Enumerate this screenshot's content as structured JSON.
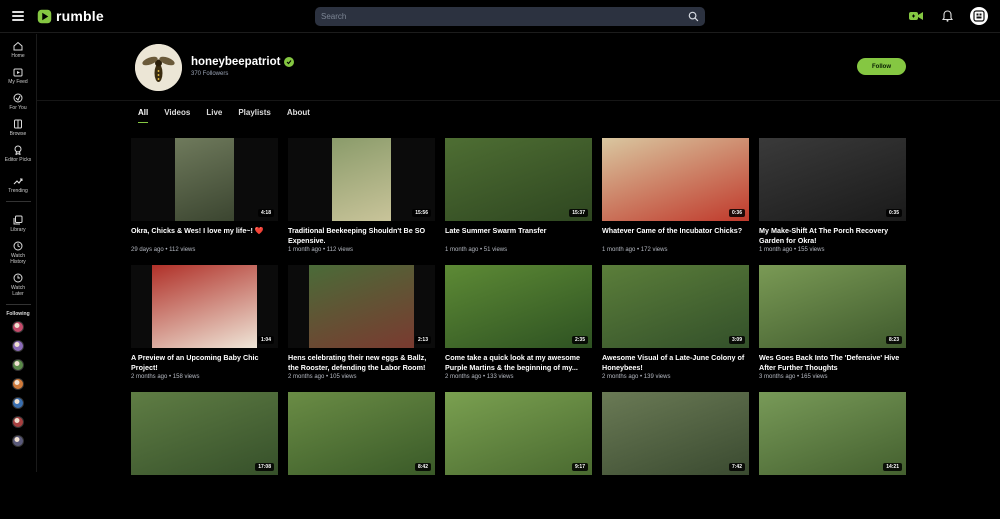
{
  "brand": {
    "name": "rumble",
    "accent": "#85c742"
  },
  "search": {
    "placeholder": "Search"
  },
  "topbar_icons": [
    "menu-icon",
    "search-icon",
    "upload-camera-icon",
    "bell-icon",
    "user-avatar-icon"
  ],
  "sidebar": {
    "items": [
      {
        "label": "Home",
        "icon": "home-icon"
      },
      {
        "label": "My Feed",
        "icon": "feed-icon"
      },
      {
        "label": "For You",
        "icon": "for-you-icon"
      },
      {
        "label": "Browse",
        "icon": "browse-icon"
      },
      {
        "label": "Editor Picks",
        "icon": "editor-picks-icon"
      },
      {
        "label": "Trending",
        "icon": "trending-icon"
      },
      {
        "label": "Library",
        "icon": "library-icon"
      },
      {
        "label": "Watch History",
        "icon": "history-icon"
      },
      {
        "label": "Watch Later",
        "icon": "clock-icon"
      }
    ],
    "following_label": "Following",
    "following_colors": [
      "#c44a6a",
      "#8a6bb8",
      "#5b8a4a",
      "#d07a3a",
      "#3a6fb0",
      "#a84040",
      "#5a5a7a"
    ]
  },
  "channel": {
    "name": "honeybeepatriot",
    "followers": "370 Followers",
    "follow_label": "Follow"
  },
  "tabs": [
    {
      "label": "All",
      "active": true
    },
    {
      "label": "Videos",
      "active": false
    },
    {
      "label": "Live",
      "active": false
    },
    {
      "label": "Playlists",
      "active": false
    },
    {
      "label": "About",
      "active": false
    }
  ],
  "videos": [
    {
      "title": "Okra, Chicks & Wes! I love my life~! ❤️",
      "meta": "29 days ago • 112 views",
      "duration": "4:18",
      "palette": [
        "#6f7a5c",
        "#3b4530"
      ],
      "fit": "narrow"
    },
    {
      "title": "Traditional Beekeeping Shouldn't Be SO Expensive.",
      "meta": "1 month ago • 112 views",
      "duration": "15:56",
      "palette": [
        "#8a9b6a",
        "#c9c49a"
      ],
      "fit": "narrow"
    },
    {
      "title": "Late Summer Swarm Transfer",
      "meta": "1 month ago • 51 views",
      "duration": "15:37",
      "palette": [
        "#4e6e33",
        "#2e4620"
      ],
      "fit": "full"
    },
    {
      "title": "Whatever Came of the Incubator Chicks?",
      "meta": "1 month ago • 172 views",
      "duration": "0:36",
      "palette": [
        "#d9c7a0",
        "#c0392b"
      ],
      "fit": "full"
    },
    {
      "title": "My Make-Shift At The Porch Recovery Garden for Okra!",
      "meta": "1 month ago • 155 views",
      "duration": "0:35",
      "palette": [
        "#3a3a3a",
        "#1a1a1a"
      ],
      "fit": "full"
    },
    {
      "title": "A Preview of an Upcoming Baby Chic Project!",
      "meta": "2 months ago • 158 views",
      "duration": "1:04",
      "palette": [
        "#b03028",
        "#efe6d8"
      ],
      "fit": "narrow"
    },
    {
      "title": "Hens celebrating their new eggs & Ballz, the Rooster, defending the Labor Room!",
      "meta": "2 months ago • 105 views",
      "duration": "2:13",
      "palette": [
        "#4a6b38",
        "#7a3a30"
      ],
      "fit": "narrow"
    },
    {
      "title": "Come take a quick look at my awesome Purple Martins & the beginning of my...",
      "meta": "2 months ago • 133 views",
      "duration": "2:35",
      "palette": [
        "#5d8a35",
        "#2e5222"
      ],
      "fit": "full"
    },
    {
      "title": "Awesome Visual of a Late-June Colony of Honeybees!",
      "meta": "2 months ago • 139 views",
      "duration": "3:09",
      "palette": [
        "#5b7e3a",
        "#33502a"
      ],
      "fit": "full"
    },
    {
      "title": "Wes Goes Back Into The 'Defensive' Hive After Further Thoughts",
      "meta": "3 months ago • 165 views",
      "duration": "8:23",
      "palette": [
        "#7a9a55",
        "#3f5a2d"
      ],
      "fit": "full"
    },
    {
      "title": "",
      "meta": "",
      "duration": "17:08",
      "palette": [
        "#5f7d44",
        "#36502a"
      ],
      "fit": "full"
    },
    {
      "title": "",
      "meta": "",
      "duration": "8:42",
      "palette": [
        "#6a8c45",
        "#3a5a28"
      ],
      "fit": "full"
    },
    {
      "title": "",
      "meta": "",
      "duration": "9:17",
      "palette": [
        "#7aa050",
        "#4a6a30"
      ],
      "fit": "full"
    },
    {
      "title": "",
      "meta": "",
      "duration": "7:42",
      "palette": [
        "#6a7a55",
        "#3a4a30"
      ],
      "fit": "full"
    },
    {
      "title": "",
      "meta": "",
      "duration": "14:21",
      "palette": [
        "#789a58",
        "#44602f"
      ],
      "fit": "full"
    }
  ]
}
